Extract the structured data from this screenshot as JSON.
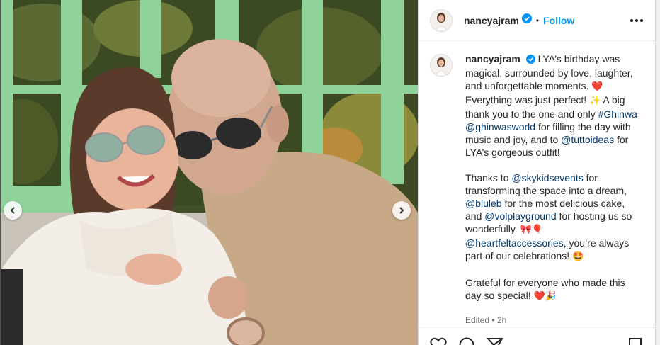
{
  "post": {
    "username": "nancyajram",
    "follow_label": "Follow",
    "separator": "•",
    "caption": {
      "line1": "LYA’s birthday was magical, surrounded by love, laughter, and unforgettable moments.",
      "emoji_heart": "❤️",
      "line2": "Everything was just perfect!",
      "emoji_sparkle": "✨",
      "line3": "A big thank you to the one and only",
      "hashtag_ghinwa": "#Ghinwa",
      "mention_ghinwasworld": "@ghinwasworld",
      "line4": "for filling the day with music and joy, and to",
      "mention_tuttoideas": "@tuttoideas",
      "line5": "for LYA’s gorgeous outfit!",
      "thanks_intro": "Thanks to",
      "mention_skykidsevents": "@skykidsevents",
      "line6": "for transforming the space into a dream,",
      "mention_bluleb": "@bluleb",
      "line7": "for the most delicious cake, and",
      "mention_volplayground": "@volplayground",
      "line8": "for hosting us so wonderfully.",
      "emoji_bow_balloon": "🎀🎈",
      "mention_heartfelt": "@heartfeltaccessories",
      "line9": ", you’re always part of our celebrations!",
      "emoji_starstruck": "🤩",
      "line10": "Grateful for everyone who made this day so special!",
      "emoji_end": "❤️🎉"
    },
    "edited_label": "Edited",
    "time_ago": "2h"
  },
  "colors": {
    "accent": "#0095f6",
    "mention": "#00376b",
    "verified": "#0095f6",
    "muted": "#737373"
  },
  "icons": {
    "prev": "chevron-left-icon",
    "next": "chevron-right-icon",
    "more": "more-options-icon",
    "verified": "verified-badge-icon",
    "like": "heart-icon",
    "comment": "comment-icon",
    "share": "share-icon",
    "save": "bookmark-icon"
  }
}
